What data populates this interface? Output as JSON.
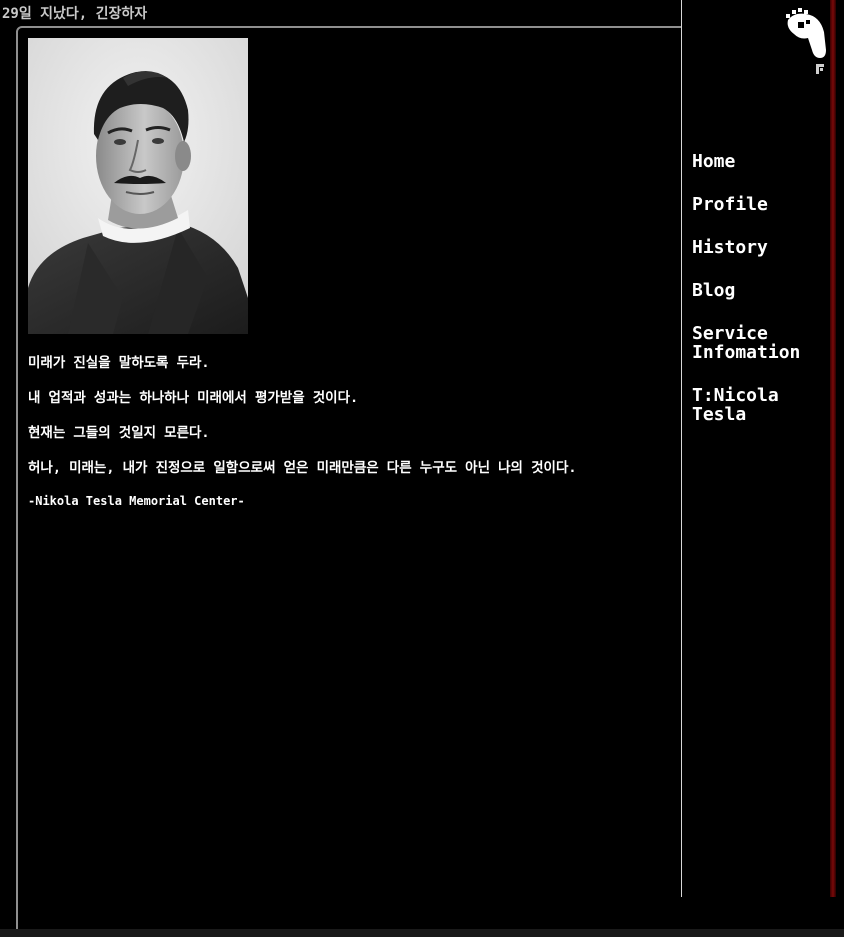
{
  "page": {
    "title": "29일 지났다, 긴장하자"
  },
  "main": {
    "portrait_alt": "portrait photograph",
    "lines": [
      "미래가 진실을 말하도록 두라.",
      "내 업적과 성과는 하나하나 미래에서 평가받을 것이다.",
      "현재는 그들의 것일지 모른다.",
      "허나, 미래는, 내가 진정으로 일함으로써 얻은 미래만큼은 다른 누구도 아닌 나의 것이다."
    ],
    "signature": "-Nikola Tesla Memorial Center-"
  },
  "sidebar": {
    "logo_icon": "pixel-hand-cursor-icon",
    "nav": [
      {
        "label": "Home"
      },
      {
        "label": "Profile"
      },
      {
        "label": "History"
      },
      {
        "label": "Blog"
      },
      {
        "label": "Service Infomation"
      },
      {
        "label": "T:Nicola Tesla"
      }
    ]
  },
  "colors": {
    "background": "#000000",
    "text": "#ffffff",
    "frame_border": "#8f8f8f",
    "sidebar_edge": "#7a0a0a"
  }
}
